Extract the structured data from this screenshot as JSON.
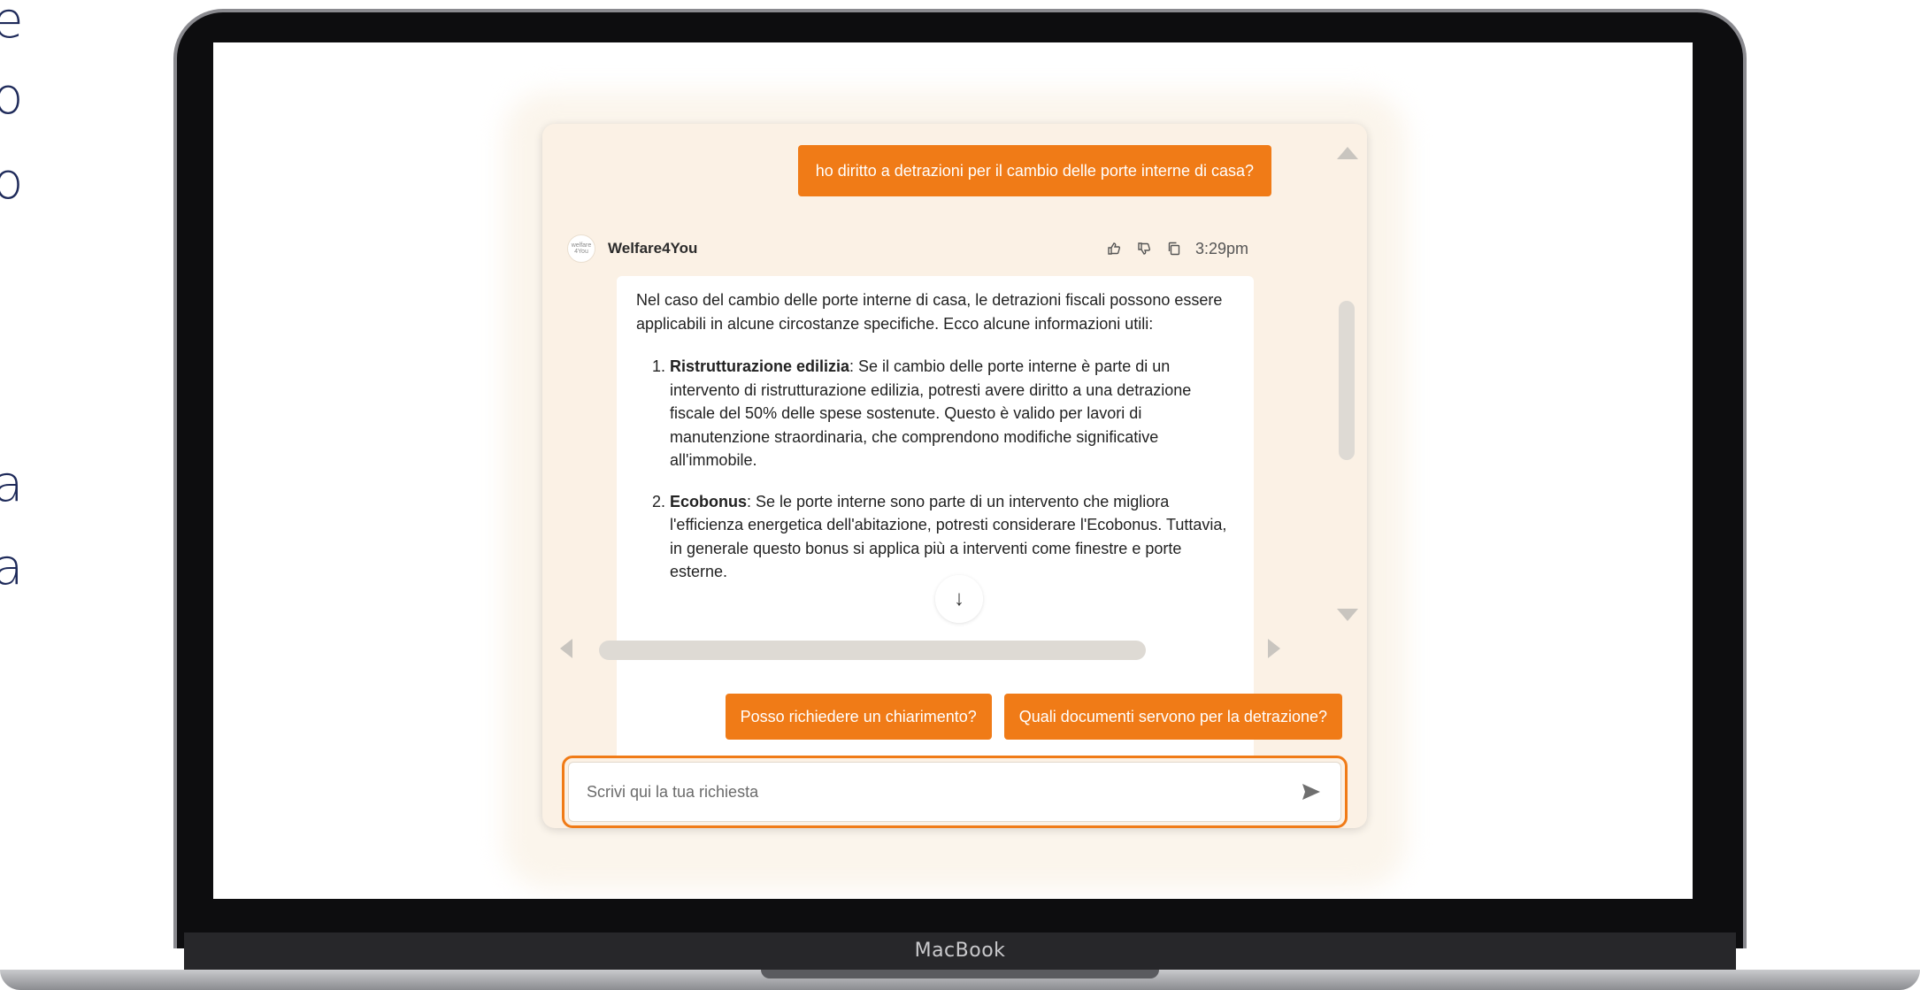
{
  "slide_edge_text": [
    "e",
    "o",
    "o",
    "a",
    "a"
  ],
  "laptop": {
    "brand": "MacBook"
  },
  "chat": {
    "user_message": "ho diritto a detrazioni per il cambio delle porte interne di casa?",
    "bot": {
      "name": "Welfare4You",
      "avatar_text": "welfare 4You",
      "time": "3:29pm",
      "action_icons": [
        "thumbs-up-icon",
        "thumbs-down-icon",
        "copy-icon"
      ],
      "intro": "Nel caso del cambio delle porte interne di casa, le detrazioni fiscali possono essere applicabili in alcune circostanze specifiche. Ecco alcune informazioni utili:",
      "items": [
        {
          "title": "Ristrutturazione edilizia",
          "text": ": Se il cambio delle porte interne è parte di un intervento di ristrutturazione edilizia, potresti avere diritto a una detrazione fiscale del 50% delle spese sostenute. Questo è valido per lavori di manutenzione straordinaria, che comprendono modifiche significative all'immobile."
        },
        {
          "title": "Ecobonus",
          "text": ": Se le porte interne sono parte di un intervento che migliora l'efficienza energetica dell'abitazione, potresti considerare l'Ecobonus. Tuttavia, in generale questo bonus si applica più a interventi come finestre e porte esterne."
        }
      ]
    },
    "suggestions": [
      "Posso richiedere un chiarimento?",
      "Quali documenti servono per la detrazione?"
    ],
    "input": {
      "placeholder": "Scrivi qui la tua richiesta",
      "value": ""
    },
    "accent_color": "#f07b17"
  }
}
